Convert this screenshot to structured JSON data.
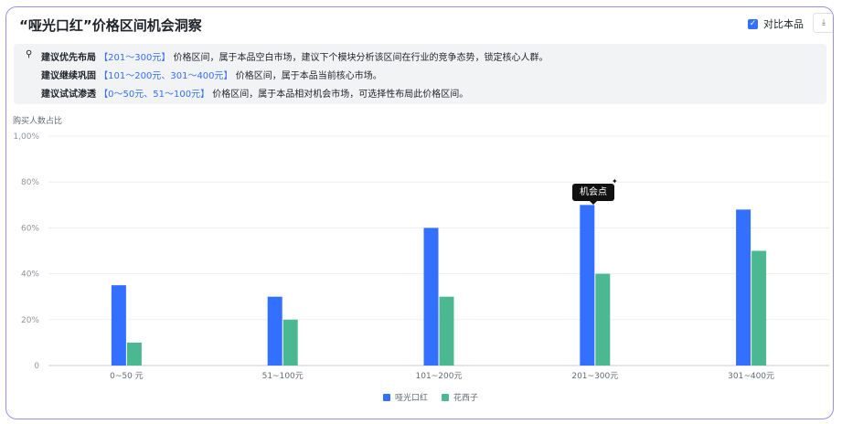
{
  "header": {
    "title": "“哑光口红”价格区间机会洞察",
    "compare_label": "对比本品",
    "compare_checked": true
  },
  "insights": [
    {
      "lead": "建议优先布局",
      "range": "【201～300元】",
      "rest": "价格区间，属于本品空白市场，建议下个模块分析该区间在行业的竞争态势，锁定核心人群。"
    },
    {
      "lead": "建议继续巩固",
      "range": "【101～200元、301～400元】",
      "rest": "价格区间，属于本品当前核心市场。"
    },
    {
      "lead": "建议试试渗透",
      "range": "【0～50元、51～100元】",
      "rest": "价格区间，属于本品相对机会市场，可选择性布局此价格区间。"
    }
  ],
  "tooltip": {
    "label": "机会点"
  },
  "colors": {
    "series1": "#3370ff",
    "series2": "#4cb891",
    "accent": "#3370ff"
  },
  "chart_data": {
    "type": "bar",
    "ylabel": "购买人数占比",
    "ylim": [
      0,
      100
    ],
    "yticks": [
      "0",
      "20%",
      "40%",
      "60%",
      "80%",
      "1,00%"
    ],
    "categories": [
      "0~50 元",
      "51~100元",
      "101~200元",
      "201~300元",
      "301~400元"
    ],
    "series": [
      {
        "name": "哑光口红",
        "values": [
          35,
          30,
          60,
          70,
          68
        ]
      },
      {
        "name": "花西子",
        "values": [
          10,
          20,
          30,
          40,
          50
        ]
      }
    ],
    "legend": "bottom-center",
    "grid": true,
    "annotation": {
      "text": "机会点",
      "category_index": 3,
      "series_index": 0
    }
  }
}
